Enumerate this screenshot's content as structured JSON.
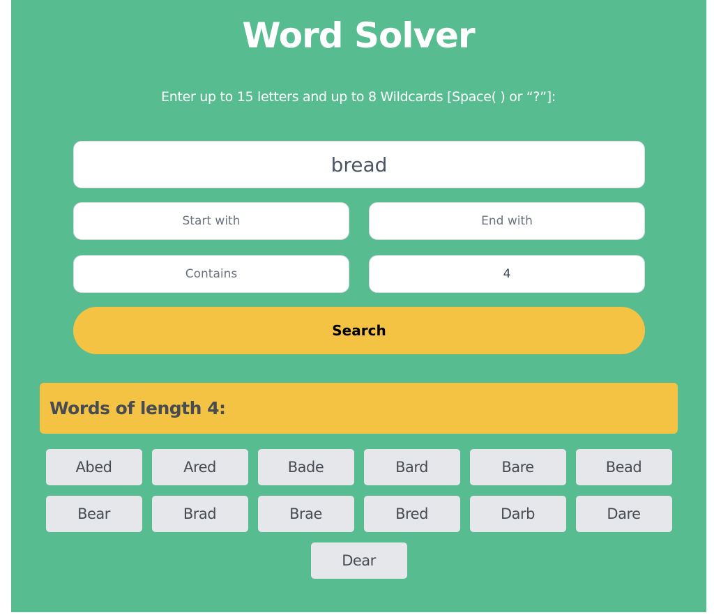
{
  "colors": {
    "background": "#57bd91",
    "accent": "#f5c344",
    "word_tile": "#e5e7eb"
  },
  "header": {
    "title": "Word Solver",
    "subtitle": "Enter up to 15 letters and up to 8 Wildcards [Space( ) or “?”]:"
  },
  "form": {
    "letters_value": "bread",
    "start_with_placeholder": "Start with",
    "end_with_placeholder": "End with",
    "contains_placeholder": "Contains",
    "length_value": "4",
    "search_label": "Search"
  },
  "results": {
    "heading": "Words of length 4:",
    "words": [
      "Abed",
      "Ared",
      "Bade",
      "Bard",
      "Bare",
      "Bead",
      "Bear",
      "Brad",
      "Brae",
      "Bred",
      "Darb",
      "Dare",
      "Dear"
    ]
  }
}
